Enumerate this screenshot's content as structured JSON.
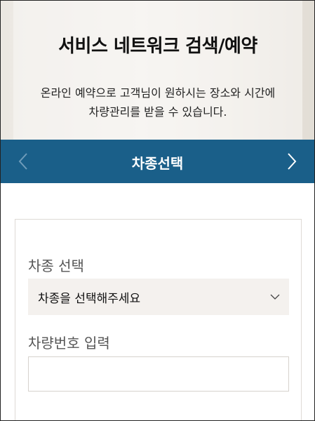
{
  "hero": {
    "title": "서비스 네트워크 검색/예약",
    "description_line1": "온라인 예약으로 고객님이 원하시는 장소와 시간에",
    "description_line2": "차량관리를 받을 수 있습니다."
  },
  "step_nav": {
    "title": "차종선택",
    "prev_icon": "chevron-left-icon",
    "next_icon": "chevron-right-icon",
    "background": "#1a5f89"
  },
  "form": {
    "model_label": "차종 선택",
    "model_select_value": "차종을 선택해주세요",
    "model_select_icon": "chevron-down-icon",
    "number_label": "차량번호 입력",
    "number_input_value": "",
    "number_input_placeholder": ""
  }
}
